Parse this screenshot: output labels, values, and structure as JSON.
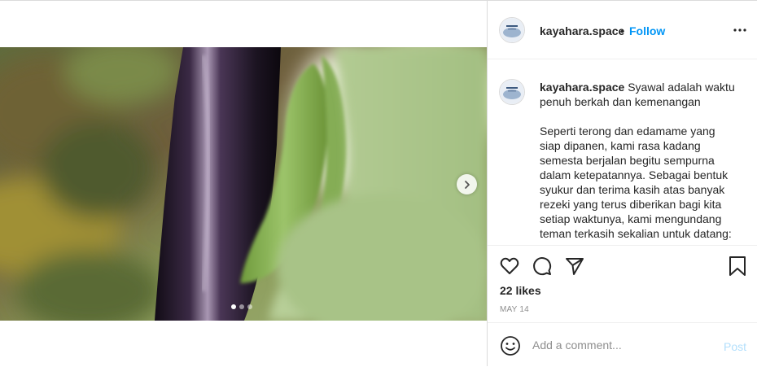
{
  "account": {
    "username": "kayahara.space",
    "separator": "•",
    "follow_label": "Follow"
  },
  "caption": {
    "username": "kayahara.space",
    "line1": "Syawal adalah waktu penuh berkah dan kemenangan",
    "paragraph2": "Seperti terong dan edamame yang siap dipanen, kami rasa kadang semesta berjalan begitu sempurna dalam ketepatannya. Sebagai bentuk syukur dan terima kasih atas banyak rezeki yang terus diberikan bagi kita setiap waktunya, kami mengundang teman terkasih sekalian untuk datang:"
  },
  "stats": {
    "likes": "22 likes",
    "date": "MAY 14"
  },
  "comment": {
    "placeholder": "Add a comment...",
    "post_label": "Post"
  },
  "carousel": {
    "slide_count": 3,
    "active_index": 0
  },
  "icons": {
    "more": "more-options-icon",
    "next": "chevron-right-icon",
    "like": "heart-icon",
    "comment": "comment-icon",
    "share": "paper-plane-icon",
    "save": "bookmark-icon",
    "emoji": "emoji-icon"
  },
  "colors": {
    "link_blue": "#0095f6",
    "post_disabled": "#b2dffc",
    "muted": "#8e8e8e",
    "text": "#262626",
    "border": "#dbdbdb"
  }
}
